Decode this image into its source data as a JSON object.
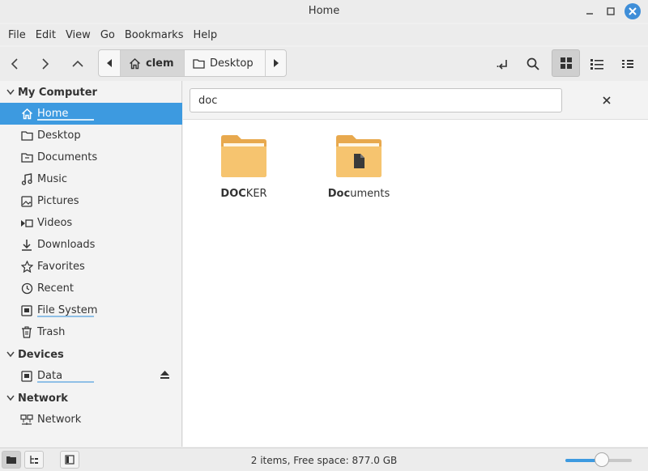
{
  "window": {
    "title": "Home"
  },
  "menubar": {
    "items": [
      "File",
      "Edit",
      "View",
      "Go",
      "Bookmarks",
      "Help"
    ]
  },
  "toolbar": {
    "path": [
      {
        "label": "clem",
        "icon": "home-icon",
        "active": true
      },
      {
        "label": "Desktop",
        "icon": "folder-icon",
        "active": false
      }
    ]
  },
  "sidebar": {
    "sections": [
      {
        "title": "My Computer",
        "items": [
          "Home",
          "Desktop",
          "Documents",
          "Music",
          "Pictures",
          "Videos",
          "Downloads",
          "Favorites",
          "Recent",
          "File System",
          "Trash"
        ]
      },
      {
        "title": "Devices",
        "items": [
          "Data"
        ]
      },
      {
        "title": "Network",
        "items": [
          "Network"
        ]
      }
    ],
    "selected": "Home"
  },
  "search": {
    "value": "doc"
  },
  "files": [
    {
      "match": "DOC",
      "rest": "KER",
      "icon": "folder-icon"
    },
    {
      "match": "Doc",
      "rest": "uments",
      "icon": "documents-folder-icon"
    }
  ],
  "status": {
    "text": "2 items, Free space: 877.0 GB",
    "zoom_level": 0.55
  },
  "colors": {
    "accent": "#3d9ae0",
    "folder": "#f6c16b"
  }
}
